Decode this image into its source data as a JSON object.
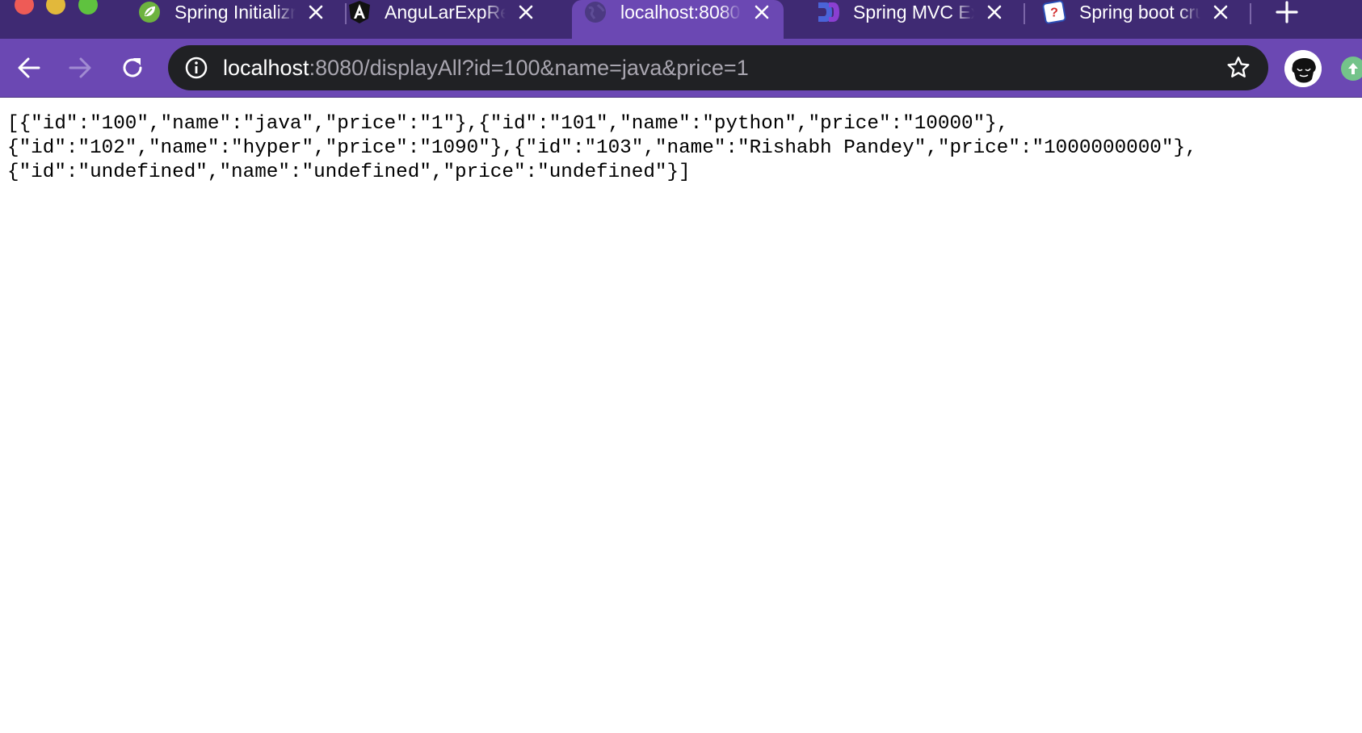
{
  "tabs": [
    {
      "title": "Spring Initializr",
      "favicon": "spring-leaf-icon",
      "active": false
    },
    {
      "title": "AnguLarExpRest",
      "favicon": "angular-icon",
      "active": false
    },
    {
      "title": "localhost:8080",
      "favicon": "globe-icon",
      "active": true
    },
    {
      "title": "Spring MVC Example",
      "favicon": "jetbrains-icon",
      "active": false
    },
    {
      "title": "Spring boot crud",
      "favicon": "quiz-icon",
      "active": false
    }
  ],
  "toolbar": {
    "url_host": "localhost",
    "url_path": ":8080/displayAll?id=100&name=java&price=1"
  },
  "content": {
    "lines": [
      "[{\"id\":\"100\",\"name\":\"java\",\"price\":\"1\"},{\"id\":\"101\",\"name\":\"python\",\"price\":\"10000\"},",
      "{\"id\":\"102\",\"name\":\"hyper\",\"price\":\"1090\"},{\"id\":\"103\",\"name\":\"Rishabh Pandey\",\"price\":\"1000000000\"},",
      "{\"id\":\"undefined\",\"name\":\"undefined\",\"price\":\"undefined\"}]"
    ]
  },
  "colors": {
    "chrome_dark": "#3f2a73",
    "chrome_light": "#6b48b3",
    "omnibox": "#202124",
    "url_muted": "#a9a6b0"
  }
}
